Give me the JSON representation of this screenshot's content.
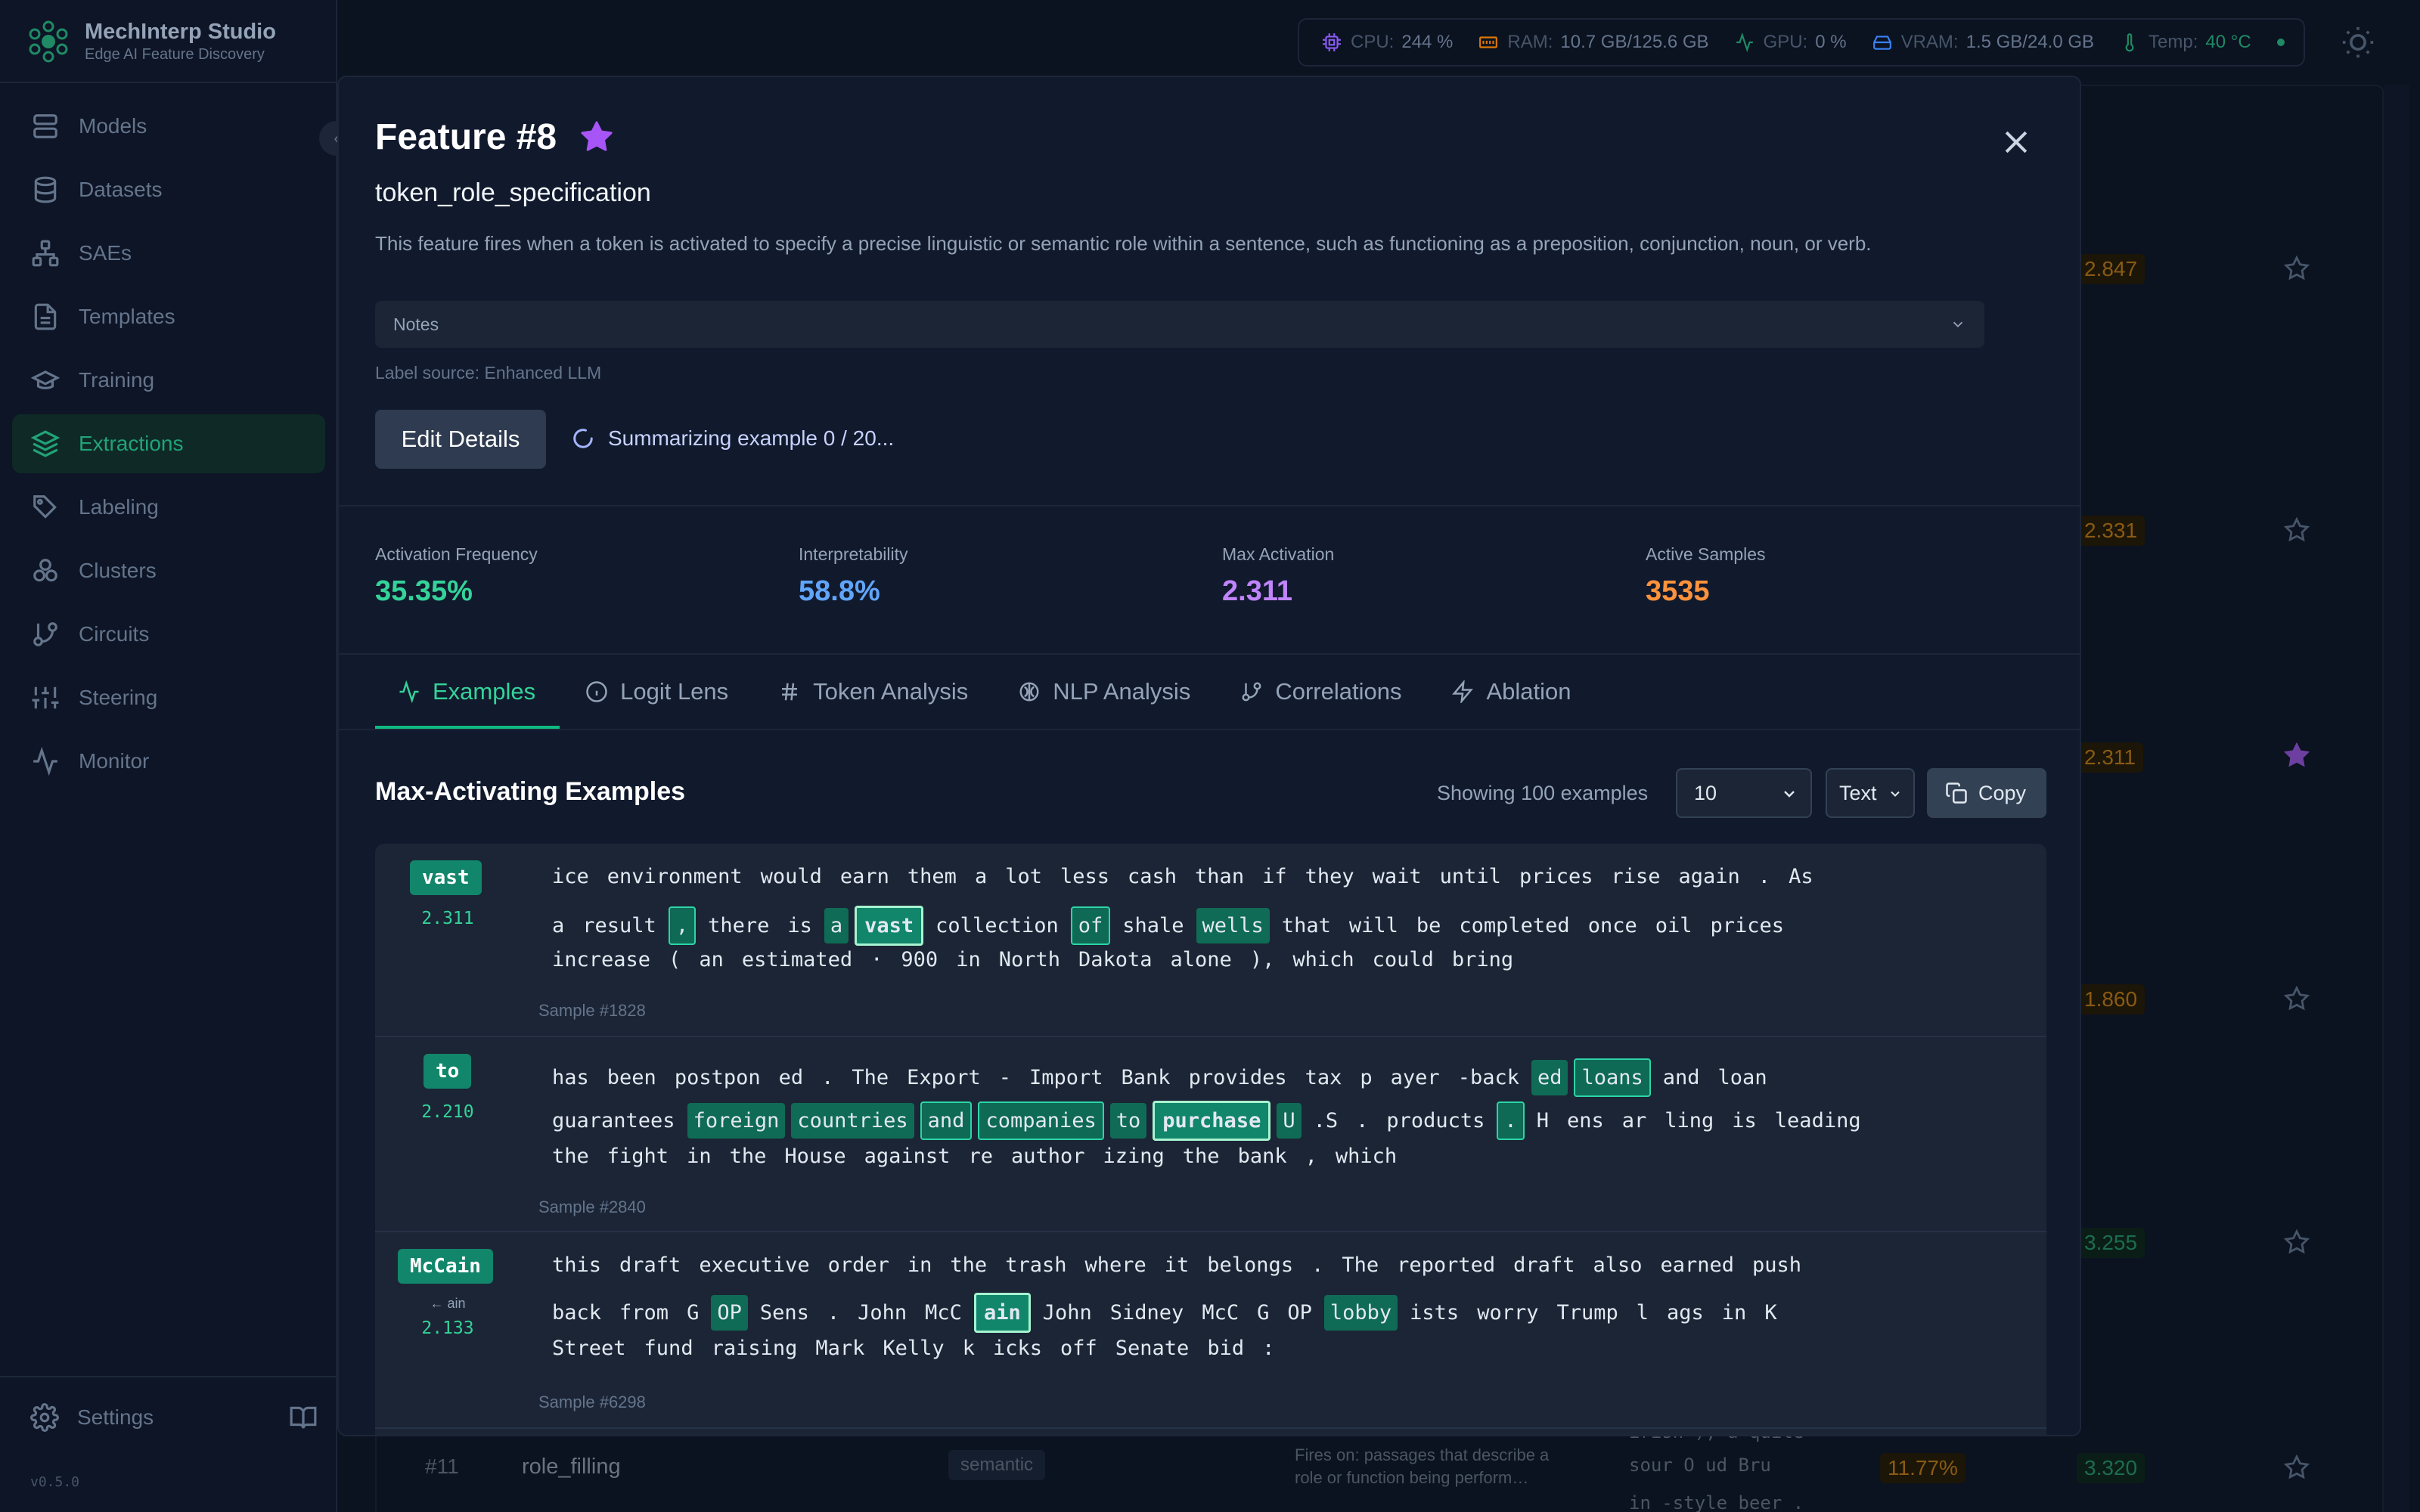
{
  "app": {
    "title": "MechInterp Studio",
    "subtitle": "Edge AI Feature Discovery",
    "version": "v0.5.0"
  },
  "sidebar": {
    "items": [
      {
        "label": "Models",
        "icon": "server-icon"
      },
      {
        "label": "Datasets",
        "icon": "database-icon"
      },
      {
        "label": "SAEs",
        "icon": "network-icon"
      },
      {
        "label": "Templates",
        "icon": "file-text-icon"
      },
      {
        "label": "Training",
        "icon": "graduation-cap-icon"
      },
      {
        "label": "Extractions",
        "icon": "layers-icon",
        "active": true
      },
      {
        "label": "Labeling",
        "icon": "tags-icon"
      },
      {
        "label": "Clusters",
        "icon": "circles-icon"
      },
      {
        "label": "Circuits",
        "icon": "git-branch-icon"
      },
      {
        "label": "Steering",
        "icon": "sliders-icon"
      },
      {
        "label": "Monitor",
        "icon": "activity-icon"
      }
    ],
    "settings_label": "Settings"
  },
  "status": {
    "cpu_label": "CPU:",
    "cpu": "244 %",
    "ram_label": "RAM:",
    "ram": "10.7 GB/125.6 GB",
    "gpu_label": "GPU:",
    "gpu": "0 %",
    "vram_label": "VRAM:",
    "vram": "1.5 GB/24.0 GB",
    "temp_label": "Temp:",
    "temp": "40 °C"
  },
  "background": {
    "values": [
      "2.847",
      "2.331",
      "2.311",
      "1.860",
      "3.255",
      "3.320"
    ],
    "row11": {
      "id": "#11",
      "name": "role_filling",
      "category": "semantic",
      "desc": "Fires on: passages that describe a role or function being perform…",
      "tokens_1": "irish ), a quite",
      "tokens_2": "sour O ud Bru",
      "tokens_3": "in -style beer .",
      "pct": "11.77%"
    }
  },
  "modal": {
    "title": "Feature #8",
    "name": "token_role_specification",
    "description": "This feature fires when a token is activated to specify a precise linguistic or semantic role within a sentence, such as functioning as a preposition, conjunction, noun, or verb.",
    "notes_label": "Notes",
    "label_source": "Label source: Enhanced LLM",
    "edit_button": "Edit Details",
    "summarizing": "Summarizing example 0 / 20...",
    "stats": [
      {
        "label": "Activation Frequency",
        "value": "35.35%",
        "color": "#34d399"
      },
      {
        "label": "Interpretability",
        "value": "58.8%",
        "color": "#60a5fa"
      },
      {
        "label": "Max Activation",
        "value": "2.311",
        "color": "#c084fc"
      },
      {
        "label": "Active Samples",
        "value": "3535",
        "color": "#fb923c"
      }
    ],
    "tabs": [
      "Examples",
      "Logit Lens",
      "Token Analysis",
      "NLP Analysis",
      "Correlations",
      "Ablation"
    ],
    "section_title": "Max-Activating Examples",
    "showing": "Showing 100 examples",
    "count_select": "10",
    "format_select": "Text",
    "copy_button": "Copy"
  },
  "examples": [
    {
      "token": "vast",
      "arrow": "",
      "activation": "2.311",
      "sample": "Sample #1828",
      "lines": [
        [
          [
            "ice",
            0
          ],
          [
            "environment",
            0
          ],
          [
            "would",
            0
          ],
          [
            "earn",
            0
          ],
          [
            "them",
            0
          ],
          [
            "a",
            0
          ],
          [
            "lot",
            0
          ],
          [
            "less",
            0
          ],
          [
            "cash",
            0
          ],
          [
            "than",
            0
          ],
          [
            "if",
            0
          ],
          [
            "they",
            0
          ],
          [
            "wait",
            0
          ],
          [
            "until",
            0
          ],
          [
            "prices",
            0
          ],
          [
            "rise",
            0
          ],
          [
            "again",
            0
          ],
          [
            ".",
            0
          ],
          [
            "As",
            0
          ]
        ],
        [
          [
            "a",
            0
          ],
          [
            "result",
            0
          ],
          [
            ",",
            2
          ],
          [
            "there",
            0
          ],
          [
            "is",
            0
          ],
          [
            "a",
            1
          ],
          [
            "vast",
            3
          ],
          [
            "collection",
            0
          ],
          [
            "of",
            2
          ],
          [
            "shale",
            0
          ],
          [
            "wells",
            1
          ],
          [
            "that",
            0
          ],
          [
            "will",
            0
          ],
          [
            "be",
            0
          ],
          [
            "completed",
            0
          ],
          [
            "once",
            0
          ],
          [
            "oil",
            0
          ],
          [
            "prices",
            0
          ]
        ],
        [
          [
            "increase",
            0
          ],
          [
            "(",
            0
          ],
          [
            "an",
            0
          ],
          [
            "estimated",
            0
          ],
          [
            "·",
            0
          ],
          [
            "900",
            0
          ],
          [
            "in",
            0
          ],
          [
            "North",
            0
          ],
          [
            "Dakota",
            0
          ],
          [
            "alone",
            0
          ],
          [
            "),",
            0
          ],
          [
            "which",
            0
          ],
          [
            "could",
            0
          ],
          [
            "bring",
            0
          ]
        ]
      ]
    },
    {
      "token": "to",
      "arrow": "",
      "activation": "2.210",
      "sample": "Sample #2840",
      "lines": [
        [
          [
            "has",
            0
          ],
          [
            "been",
            0
          ],
          [
            "postpon",
            0
          ],
          [
            "ed",
            0
          ],
          [
            ".",
            0
          ],
          [
            "The",
            0
          ],
          [
            "Export",
            0
          ],
          [
            "-",
            0
          ],
          [
            "Import",
            0
          ],
          [
            "Bank",
            0
          ],
          [
            "provides",
            0
          ],
          [
            "tax",
            0
          ],
          [
            "p",
            0
          ],
          [
            "ayer",
            0
          ],
          [
            "-back",
            0
          ],
          [
            "ed",
            1
          ],
          [
            "loans",
            2
          ],
          [
            "and",
            0
          ],
          [
            "loan",
            0
          ]
        ],
        [
          [
            "guarantees",
            0
          ],
          [
            "foreign",
            1
          ],
          [
            "countries",
            1
          ],
          [
            "and",
            2
          ],
          [
            "companies",
            2
          ],
          [
            "to",
            1
          ],
          [
            "purchase",
            3
          ],
          [
            "U",
            1
          ],
          [
            ".S",
            0
          ],
          [
            ".",
            0
          ],
          [
            "products",
            0
          ],
          [
            ".",
            2
          ],
          [
            "H",
            0
          ],
          [
            "ens",
            0
          ],
          [
            "ar",
            0
          ],
          [
            "ling",
            0
          ],
          [
            "is",
            0
          ],
          [
            "leading",
            0
          ]
        ],
        [
          [
            "the",
            0
          ],
          [
            "fight",
            0
          ],
          [
            "in",
            0
          ],
          [
            "the",
            0
          ],
          [
            "House",
            0
          ],
          [
            "against",
            0
          ],
          [
            "re",
            0
          ],
          [
            "author",
            0
          ],
          [
            "izing",
            0
          ],
          [
            "the",
            0
          ],
          [
            "bank",
            0
          ],
          [
            ",",
            0
          ],
          [
            "which",
            0
          ]
        ]
      ]
    },
    {
      "token": "McCain",
      "arrow": "← ain",
      "activation": "2.133",
      "sample": "Sample #6298",
      "lines": [
        [
          [
            "this",
            0
          ],
          [
            "draft",
            0
          ],
          [
            "executive",
            0
          ],
          [
            "order",
            0
          ],
          [
            "in",
            0
          ],
          [
            "the",
            0
          ],
          [
            "trash",
            0
          ],
          [
            "where",
            0
          ],
          [
            "it",
            0
          ],
          [
            "belongs",
            0
          ],
          [
            ".",
            0
          ],
          [
            "The",
            0
          ],
          [
            "reported",
            0
          ],
          [
            "draft",
            0
          ],
          [
            "also",
            0
          ],
          [
            "earned",
            0
          ],
          [
            "push",
            0
          ]
        ],
        [
          [
            "back",
            0
          ],
          [
            "from",
            0
          ],
          [
            "G",
            0
          ],
          [
            "OP",
            1
          ],
          [
            "Sens",
            0
          ],
          [
            ".",
            0
          ],
          [
            "John",
            0
          ],
          [
            "McC",
            0
          ],
          [
            "ain",
            3
          ],
          [
            "John",
            0
          ],
          [
            "Sidney",
            0
          ],
          [
            "McC",
            0
          ],
          [
            "G",
            0
          ],
          [
            "OP",
            0
          ],
          [
            "lobby",
            1
          ],
          [
            "ists",
            0
          ],
          [
            "worry",
            0
          ],
          [
            "Trump",
            0
          ],
          [
            "l",
            0
          ],
          [
            "ags",
            0
          ],
          [
            "in",
            0
          ],
          [
            "K",
            0
          ]
        ],
        [
          [
            "Street",
            0
          ],
          [
            "fund",
            0
          ],
          [
            "raising",
            0
          ],
          [
            "Mark",
            0
          ],
          [
            "Kelly",
            0
          ],
          [
            "k",
            0
          ],
          [
            "icks",
            0
          ],
          [
            "off",
            0
          ],
          [
            "Senate",
            0
          ],
          [
            "bid",
            0
          ],
          [
            ":",
            0
          ]
        ]
      ]
    }
  ]
}
